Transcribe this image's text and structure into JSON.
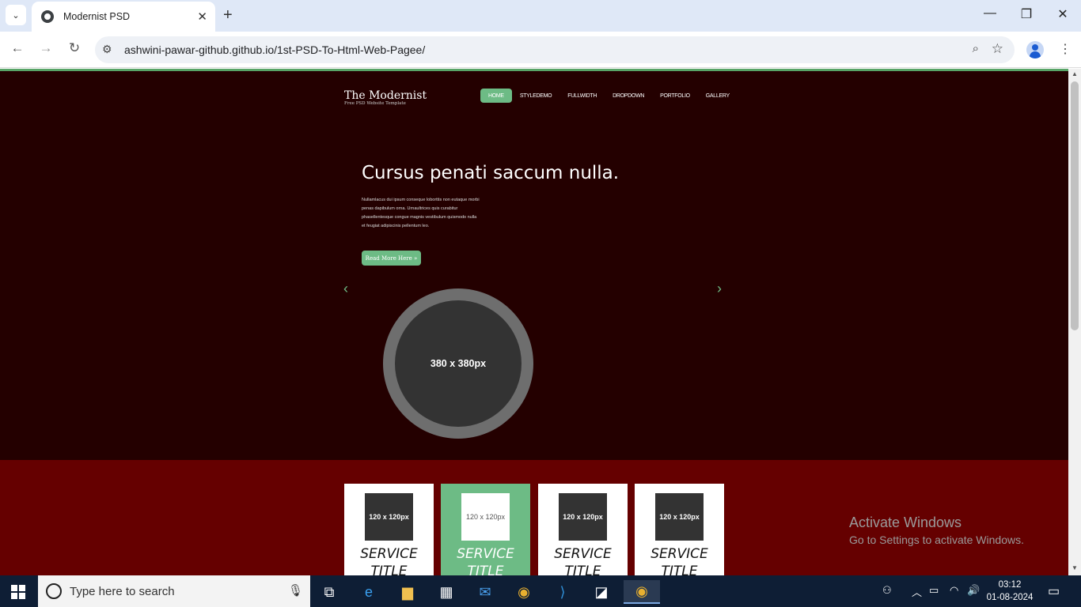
{
  "browser": {
    "tab_title": "Modernist PSD",
    "url": "ashwini-pawar-github.github.io/1st-PSD-To-Html-Web-Pagee/",
    "icons": [
      "tab-search-icon",
      "close-icon",
      "new-tab-icon",
      "minimize-icon",
      "restore-icon",
      "window-close-icon",
      "back-icon",
      "forward-icon",
      "reload-icon",
      "site-info-icon",
      "zoom-icon",
      "star-icon",
      "profile-icon",
      "menu-icon"
    ]
  },
  "site": {
    "logo": "The Modernist",
    "logo_tagline": "Free PSD Website Template",
    "nav": [
      "HOME",
      "STYLEDEMO",
      "FULLWIDTH",
      "DROPDOWN",
      "PORTFOLIO",
      "GALLERY"
    ],
    "nav_active": "HOME",
    "hero": {
      "title": "Cursus penati saccum nulla.",
      "text": "Nullamlacus dui ipsum conseque loborttis non eutaque morbi penas dapibulum orna. Urnaultrices quis curabitur phasellentesque congue magnis vestibulum quismodo nulla et feugiat adipiscinis pellentum leo.",
      "button": "Read More Here »",
      "image_placeholder": "380 x 380px",
      "prev_arrow": "‹",
      "next_arrow": "›"
    },
    "services": [
      {
        "image": "120 x 120px",
        "title": "SERVICE TITLE",
        "active": false
      },
      {
        "image": "120 x 120px",
        "title": "SERVICE TITLE",
        "active": true
      },
      {
        "image": "120 x 120px",
        "title": "SERVICE TITLE",
        "active": false
      },
      {
        "image": "120 x 120px",
        "title": "SERVICE TITLE",
        "active": false
      }
    ]
  },
  "watermark": {
    "line1": "Activate Windows",
    "line2": "Go to Settings to activate Windows."
  },
  "taskbar": {
    "search_placeholder": "Type here to search",
    "time": "03:12",
    "date": "01-08-2024",
    "apps": [
      "task-view-icon",
      "edge-icon",
      "file-explorer-icon",
      "store-icon",
      "mail-icon",
      "chrome-icon",
      "vscode-icon",
      "sticky-notes-icon",
      "chrome-active-icon"
    ]
  },
  "colors": {
    "accent_green": "#6dbb85",
    "hero_bg": "#240000",
    "services_bg": "#650000",
    "taskbar_bg": "#0e1e35"
  }
}
